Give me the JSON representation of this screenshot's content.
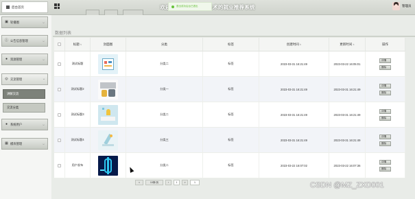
{
  "app": {
    "title": "欢迎使用基于大数据技术的就业推荐系统",
    "toast": "退出成功后台已退出"
  },
  "header": {
    "home_label": "后台首页",
    "home_icon": "home-icon",
    "menu_icon": "grid-menu-icon",
    "user_name": "管理员"
  },
  "sidebar": {
    "items": [
      {
        "label": "轮播图",
        "icon": "image-icon",
        "expanded": false
      },
      {
        "label": "公告信息管理",
        "icon": "info-icon",
        "expanded": false
      },
      {
        "label": "资源管理",
        "icon": "pin-icon",
        "expanded": false
      },
      {
        "label": "交流管理",
        "icon": "chat-icon",
        "expanded": true,
        "children": [
          {
            "label": "讲解交流",
            "active": true
          },
          {
            "label": "交流分类",
            "active": false
          }
        ]
      },
      {
        "label": "系统用户",
        "icon": "user-icon",
        "expanded": false
      },
      {
        "label": "模块管理",
        "icon": "grid-icon",
        "expanded": false
      }
    ]
  },
  "main": {
    "section_title": "数据列表",
    "columns": [
      "标题",
      "封面图",
      "分类",
      "标签",
      "创建时间",
      "更新时间",
      "操作"
    ],
    "rows": [
      {
        "title": "测试标题",
        "category": "分类二",
        "tag": "标签",
        "created": "2023-03-31 16:21:49",
        "updated": "2023-03-22 16:05:01",
        "thumb": "thumb-document-icon"
      },
      {
        "title": "测试标题2",
        "category": "分类一",
        "tag": "标签",
        "created": "2023-03-31 16:21:49",
        "updated": "2023-03-31 16:21:49",
        "thumb": "thumb-workspace-icon"
      },
      {
        "title": "测试标题3",
        "category": "分类二",
        "tag": "标签",
        "created": "2023-03-31 16:21:49",
        "updated": "2023-03-31 16:21:49",
        "thumb": "thumb-book-icon"
      },
      {
        "title": "测试标题4",
        "category": "分类三",
        "tag": "标签",
        "created": "2023-03-31 16:21:49",
        "updated": "2023-03-31 16:21:49",
        "thumb": "thumb-lamp-icon"
      },
      {
        "title": "用户发布",
        "category": "分类二",
        "tag": "标签",
        "created": "2023-03-22 16:07:02",
        "updated": "2023-03-22 16:07:36",
        "thumb": "thumb-dollar-icon"
      }
    ],
    "actions": {
      "view": "详情",
      "delete": "删除"
    }
  },
  "pagination": {
    "prev": "<",
    "per_page": "10条/页",
    "current": "1",
    "next": ">",
    "goto": "1"
  },
  "watermark": "CSDN @MZ_ZXD001",
  "colors": {
    "accent": "#7d827a",
    "toast_green": "#67c23a",
    "row_alt": "#f2f4f8"
  }
}
